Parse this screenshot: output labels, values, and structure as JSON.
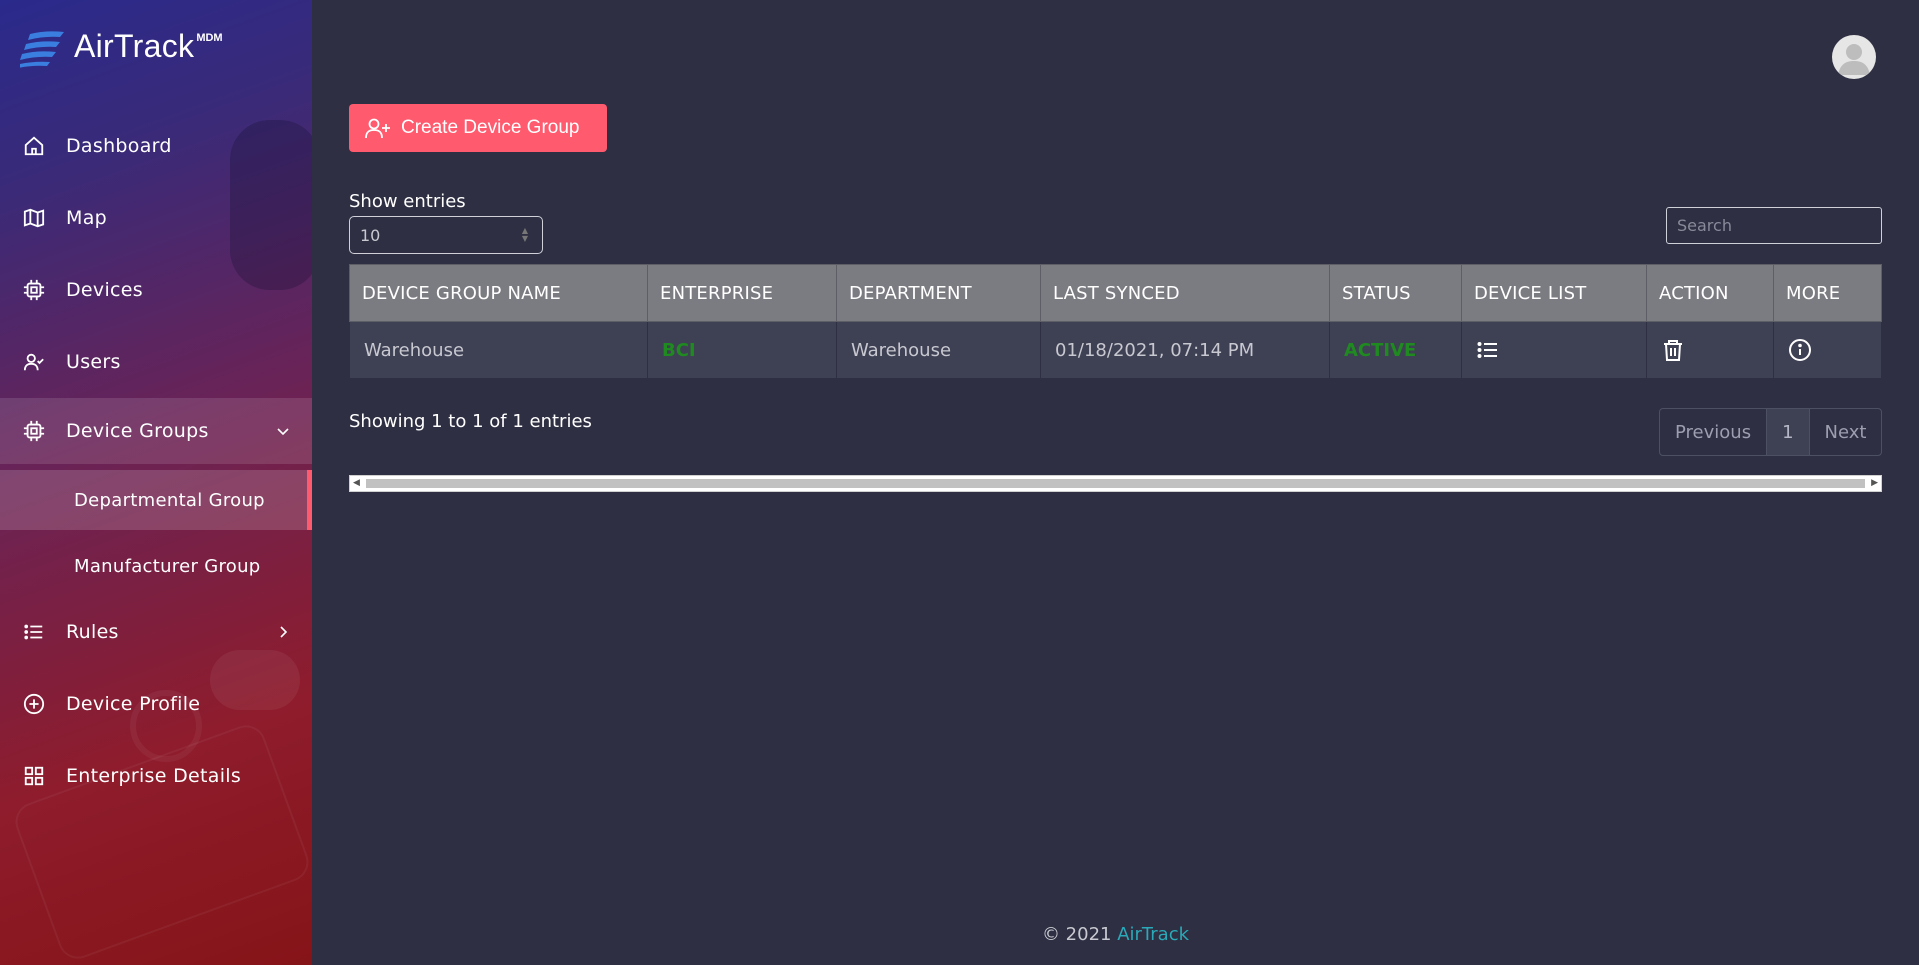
{
  "brand": {
    "name": "AirTrack",
    "superscript": "MDM"
  },
  "nav": {
    "dashboard": "Dashboard",
    "map": "Map",
    "devices": "Devices",
    "users": "Users",
    "device_groups": "Device Groups",
    "departmental_group": "Departmental Group",
    "manufacturer_group": "Manufacturer Group",
    "rules": "Rules",
    "device_profile": "Device Profile",
    "enterprise_details": "Enterprise Details"
  },
  "toolbar": {
    "create_label": "Create Device Group"
  },
  "entries": {
    "label": "Show entries",
    "value": "10"
  },
  "search": {
    "placeholder": "Search"
  },
  "table": {
    "headers": [
      "DEVICE GROUP NAME",
      "ENTERPRISE",
      "DEPARTMENT",
      "LAST SYNCED",
      "STATUS",
      "DEVICE LIST",
      "ACTION",
      "MORE"
    ],
    "rows": [
      {
        "name": "Warehouse",
        "enterprise": "BCI",
        "department": "Warehouse",
        "last_synced": "01/18/2021, 07:14 PM",
        "status": "ACTIVE"
      }
    ]
  },
  "pagination": {
    "info": "Showing 1 to 1 of 1 entries",
    "previous": "Previous",
    "page": "1",
    "next": "Next"
  },
  "footer": {
    "copyright": "© 2021",
    "brand": "AirTrack"
  },
  "colors": {
    "accent": "#ff5a6e",
    "active": "#1f8a1f",
    "link": "#2aa9b8"
  }
}
